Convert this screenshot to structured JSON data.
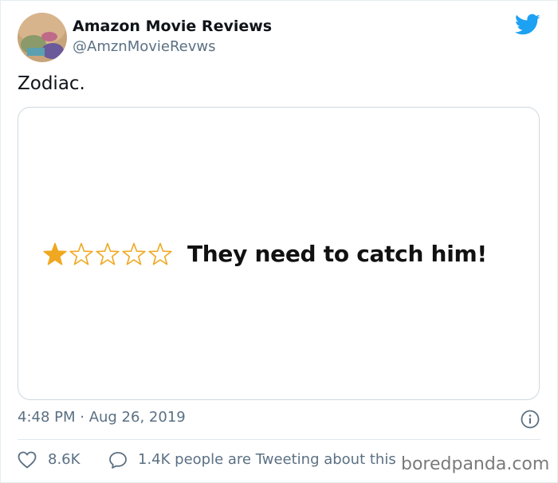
{
  "author": {
    "name": "Amazon Movie Reviews",
    "handle": "@AmznMovieRevws",
    "avatar_icon": "avatar-image"
  },
  "brand_icon": "twitter-bird-icon",
  "brand_color": "#1da1f2",
  "tweet": {
    "text": "Zodiac."
  },
  "media": {
    "rating": 1,
    "rating_max": 5,
    "star_color": "#f0a820",
    "review_title": "They need to catch him!"
  },
  "meta": {
    "timestamp": "4:48 PM · Aug 26, 2019",
    "info_icon": "info-icon"
  },
  "actions": {
    "likes": "8.6K",
    "like_icon": "heart-icon",
    "tweeting": "1.4K people are Tweeting about this",
    "reply_icon": "speech-bubble-icon"
  },
  "watermark": "boredpanda.com"
}
